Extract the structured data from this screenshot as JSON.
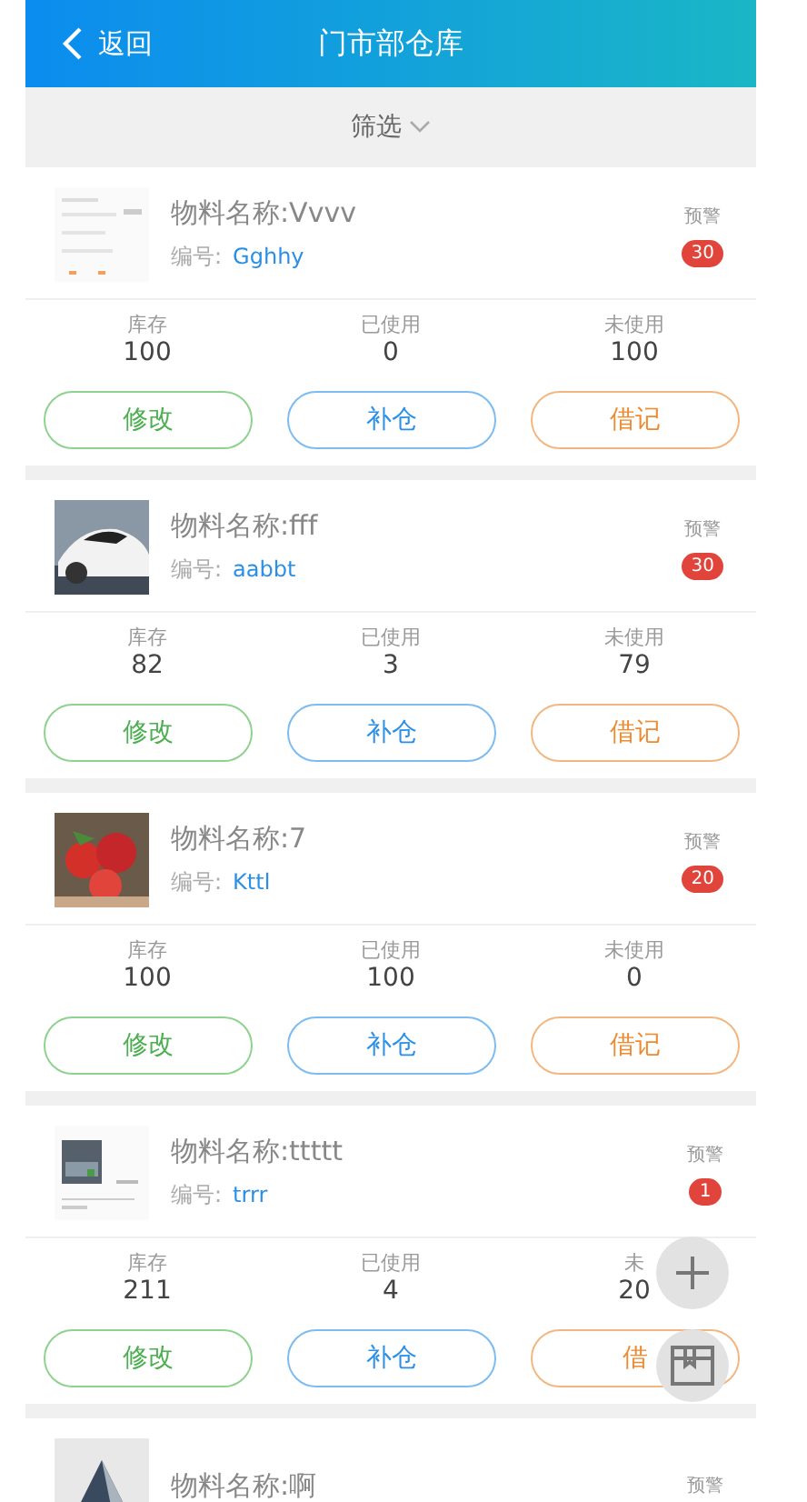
{
  "header": {
    "back_label": "返回",
    "title": "门市部仓库"
  },
  "filter": {
    "label": "筛选"
  },
  "items": [
    {
      "name": "物料名称:Vvvv",
      "code_label": "编号:",
      "code": "Gghhy",
      "alert_label": "预警",
      "alert_count": "30",
      "stats": [
        {
          "label": "库存",
          "value": "100"
        },
        {
          "label": "已使用",
          "value": "0"
        },
        {
          "label": "未使用",
          "value": "100"
        }
      ],
      "buttons": [
        {
          "label": "修改",
          "kind": "edit"
        },
        {
          "label": "补仓",
          "kind": "restock"
        },
        {
          "label": "借记",
          "kind": "debit"
        }
      ]
    },
    {
      "name": "物料名称:fff",
      "code_label": "编号:",
      "code": "aabbt",
      "alert_label": "预警",
      "alert_count": "30",
      "stats": [
        {
          "label": "库存",
          "value": "82"
        },
        {
          "label": "已使用",
          "value": "3"
        },
        {
          "label": "未使用",
          "value": "79"
        }
      ],
      "buttons": [
        {
          "label": "修改",
          "kind": "edit"
        },
        {
          "label": "补仓",
          "kind": "restock"
        },
        {
          "label": "借记",
          "kind": "debit"
        }
      ]
    },
    {
      "name": "物料名称:7",
      "code_label": "编号:",
      "code": "Kttl",
      "alert_label": "预警",
      "alert_count": "20",
      "stats": [
        {
          "label": "库存",
          "value": "100"
        },
        {
          "label": "已使用",
          "value": "100"
        },
        {
          "label": "未使用",
          "value": "0"
        }
      ],
      "buttons": [
        {
          "label": "修改",
          "kind": "edit"
        },
        {
          "label": "补仓",
          "kind": "restock"
        },
        {
          "label": "借记",
          "kind": "debit"
        }
      ]
    },
    {
      "name": "物料名称:ttttt",
      "code_label": "编号:",
      "code": "trrr",
      "alert_label": "预警",
      "alert_count": "1",
      "stats": [
        {
          "label": "库存",
          "value": "211"
        },
        {
          "label": "已使用",
          "value": "4"
        },
        {
          "label": "未",
          "value": "20"
        }
      ],
      "buttons": [
        {
          "label": "修改",
          "kind": "edit"
        },
        {
          "label": "补仓",
          "kind": "restock"
        },
        {
          "label": "借",
          "kind": "debit"
        }
      ]
    },
    {
      "name": "物料名称:啊",
      "alert_label": "预警"
    }
  ]
}
